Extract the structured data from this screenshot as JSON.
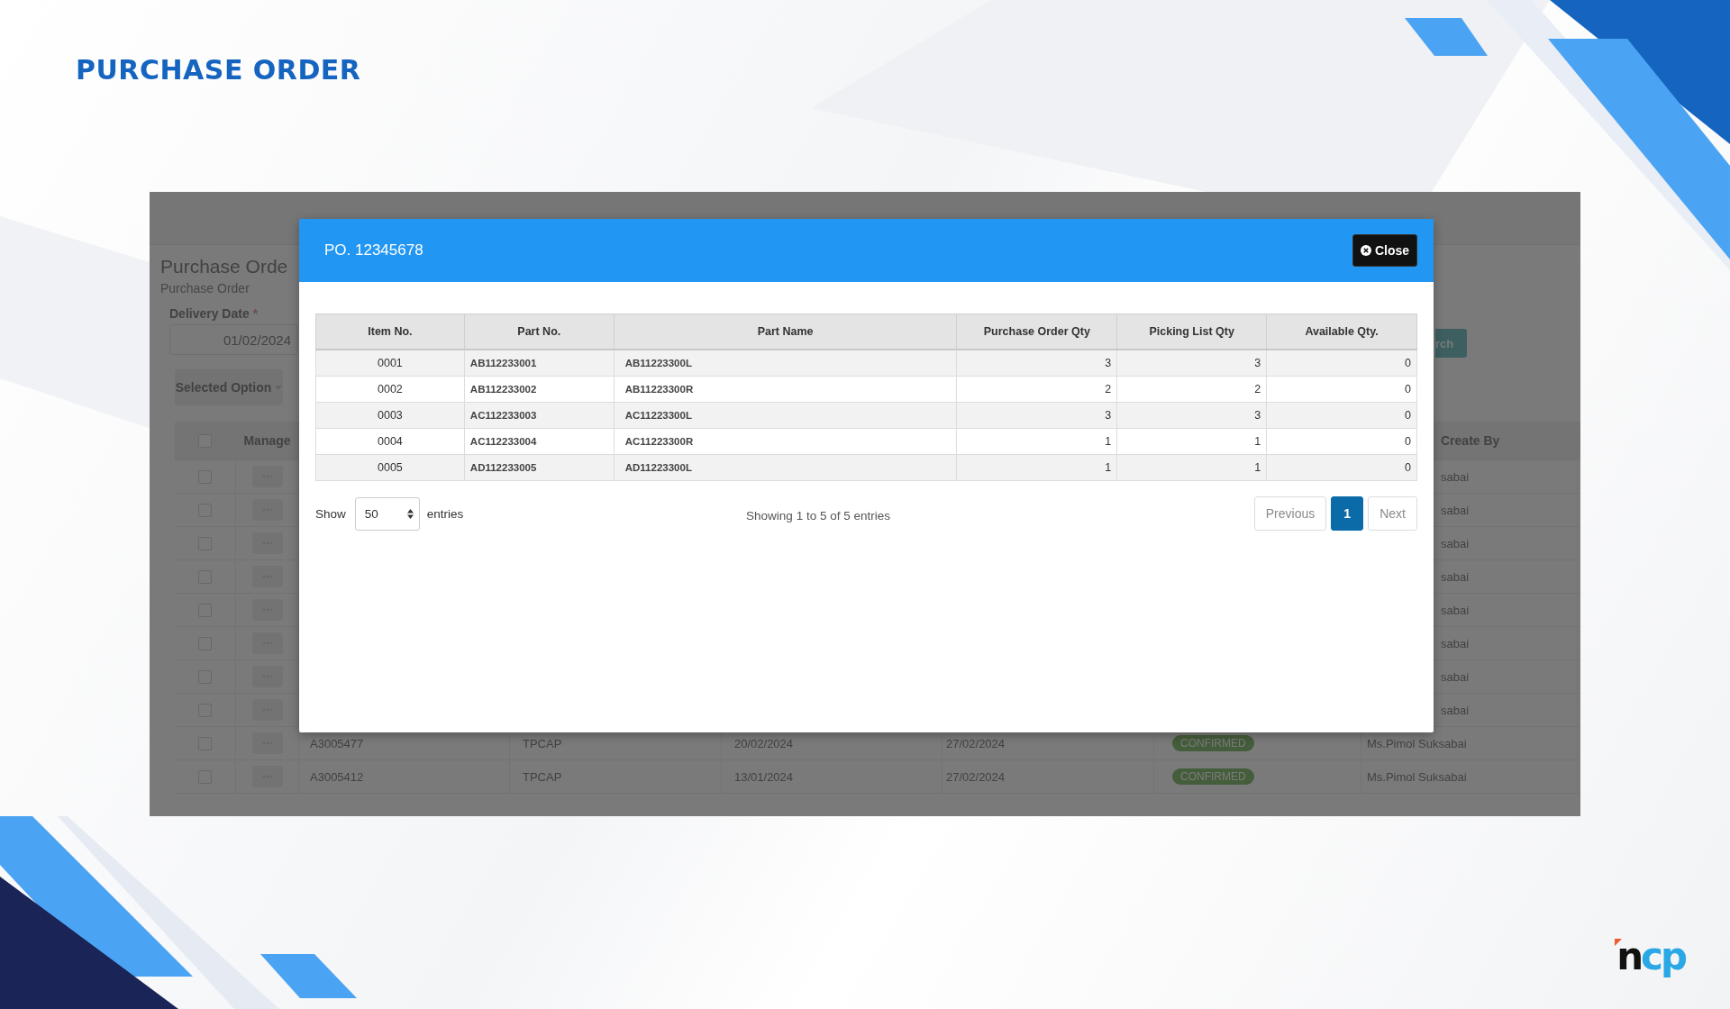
{
  "slide_title": "PURCHASE ORDER",
  "logo": "ncp",
  "page": {
    "title": "Purchase Orde",
    "breadcrumb": "Purchase Order",
    "filter": {
      "label": "Delivery Date",
      "required_mark": "*",
      "value": "01/02/2024"
    },
    "search_button": "rch",
    "options_button": "Selected Option",
    "table": {
      "header_checkbox": {
        "checked": false
      },
      "manage_header": "Manage",
      "create_by_header": "Create By",
      "rows": [
        {
          "checked": false,
          "create_by": "sabai"
        },
        {
          "checked": false,
          "create_by": "sabai"
        },
        {
          "checked": false,
          "create_by": "sabai"
        },
        {
          "checked": false,
          "create_by": "sabai"
        },
        {
          "checked": false,
          "create_by": "sabai"
        },
        {
          "checked": false,
          "create_by": "sabai"
        },
        {
          "checked": false,
          "create_by": "sabai"
        },
        {
          "checked": false,
          "create_by": "sabai"
        },
        {
          "checked": false,
          "po_no": "A3005477",
          "supplier": "TPCAP",
          "date_1": "20/02/2024",
          "date_2": "27/02/2024",
          "status": "CONFIRMED",
          "create_by": "Ms.Pimol Suksabai"
        },
        {
          "checked": false,
          "po_no": "A3005412",
          "supplier": "TPCAP",
          "date_1": "13/01/2024",
          "date_2": "27/02/2024",
          "status": "CONFIRMED",
          "create_by": "Ms.Pimol Suksabai"
        }
      ]
    }
  },
  "modal": {
    "title": "PO. 12345678",
    "close_button": "Close",
    "table": {
      "columns": [
        "Item No.",
        "Part No.",
        "Part Name",
        "Purchase Order Qty",
        "Picking List Qty",
        "Available Qty."
      ],
      "rows": [
        [
          "0001",
          "AB112233001",
          "AB11223300L",
          "3",
          "3",
          "0"
        ],
        [
          "0002",
          "AB112233002",
          "AB11223300R",
          "2",
          "2",
          "0"
        ],
        [
          "0003",
          "AC112233003",
          "AC11223300L",
          "3",
          "3",
          "0"
        ],
        [
          "0004",
          "AC112233004",
          "AC11223300R",
          "1",
          "1",
          "0"
        ],
        [
          "0005",
          "AD112233005",
          "AD11223300L",
          "1",
          "1",
          "0"
        ]
      ]
    },
    "length": {
      "label_before": "Show",
      "value": "50",
      "label_after": "entries"
    },
    "info": "Showing 1 to 5 of 5 entries",
    "pagination": [
      {
        "label": "Previous",
        "kind": "nav",
        "selected": false,
        "disabled": true
      },
      {
        "label": "1",
        "kind": "page",
        "selected": true,
        "disabled": false
      },
      {
        "label": "Next",
        "kind": "nav",
        "selected": false,
        "disabled": true
      }
    ]
  }
}
